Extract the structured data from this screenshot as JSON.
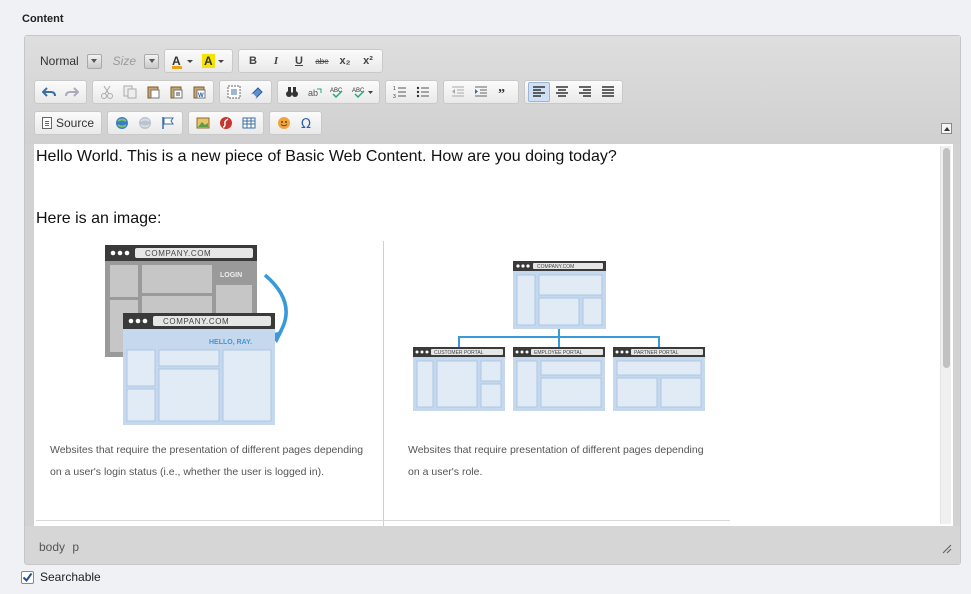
{
  "section": {
    "label": "Content"
  },
  "toolbar": {
    "format_combo": "Normal",
    "size_combo": "Size",
    "bold": "B",
    "italic": "I",
    "underline": "U",
    "strike": "abe",
    "subscript": "x₂",
    "superscript": "x²",
    "source_label": "Source"
  },
  "content": {
    "paragraph1": "Hello World. This is a new piece of Basic Web Content. How are you doing today?",
    "paragraph2": "Here is an image:",
    "figure1": {
      "browser1_url": "COMPANY.COM",
      "browser1_text": "LOGIN",
      "browser2_url": "COMPANY.COM",
      "browser2_text": "HELLO, RAY.",
      "caption": "Websites that require the presentation of different pages depending on a user's login status (i.e., whether the user is logged in)."
    },
    "figure2": {
      "top_url": "COMPANY.COM",
      "portal1": "CUSTOMER PORTAL",
      "portal2": "EMPLOYEE PORTAL",
      "portal3": "PARTNER PORTAL",
      "caption": "Websites that require presentation of different pages depending on a user's role."
    }
  },
  "status": {
    "path": "body p"
  },
  "footer": {
    "searchable_label": "Searchable",
    "searchable_checked": true
  },
  "colors": {
    "accent": "#3a9ad9",
    "panel_blue": "#c5d8ee",
    "browser_bar": "#3a3a3a"
  }
}
